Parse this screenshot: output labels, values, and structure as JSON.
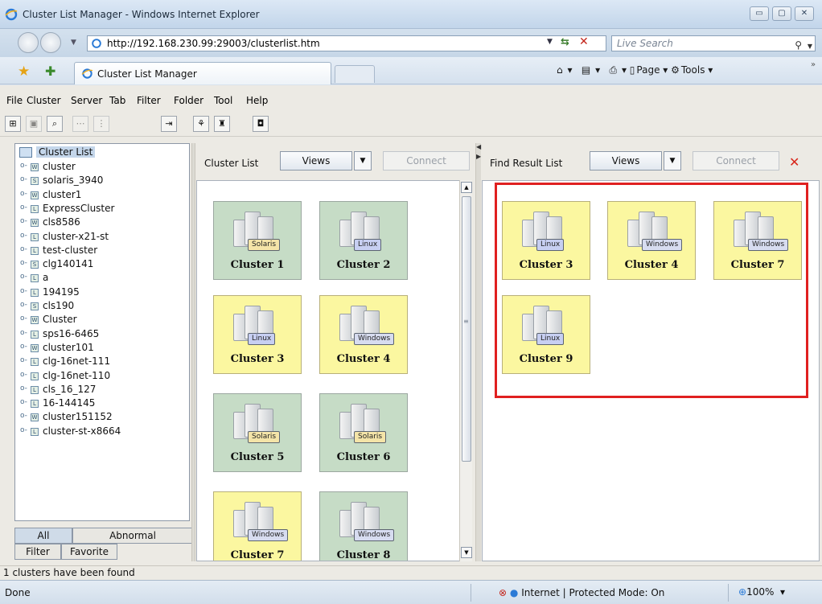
{
  "window": {
    "title": "Cluster List Manager - Windows Internet Explorer",
    "minimize": "▭",
    "maximize": "▢",
    "close": "✕"
  },
  "address": {
    "url": "http://192.168.230.99:29003/clusterlist.htm",
    "search_placeholder": "Live Search"
  },
  "tab": {
    "label": "Cluster List Manager"
  },
  "commands": {
    "page": "Page",
    "tools": "Tools"
  },
  "menu": [
    {
      "key": "F",
      "rest": "ile"
    },
    {
      "key": "C",
      "rest": "luster"
    },
    {
      "key": "S",
      "rest": "erver"
    },
    {
      "key": "",
      "rest": "Tab",
      "u_index": 2
    },
    {
      "key": "",
      "rest": "Filter"
    },
    {
      "key": "F",
      "rest": "older"
    },
    {
      "key": "T",
      "rest": "ool"
    },
    {
      "key": "H",
      "rest": "elp"
    }
  ],
  "menu_labels": [
    "File",
    "Cluster",
    "Server",
    "Tab",
    "Filter",
    "Folder",
    "Tool",
    "Help"
  ],
  "tree": {
    "root": "Cluster List",
    "items": [
      {
        "icon": "W",
        "label": "cluster"
      },
      {
        "icon": "S",
        "label": "solaris_3940"
      },
      {
        "icon": "W",
        "label": "cluster1"
      },
      {
        "icon": "L",
        "label": "ExpressCluster"
      },
      {
        "icon": "W",
        "label": "cls8586"
      },
      {
        "icon": "L",
        "label": "cluster-x21-st"
      },
      {
        "icon": "L",
        "label": "test-cluster"
      },
      {
        "icon": "S",
        "label": "clg140141"
      },
      {
        "icon": "L",
        "label": "a"
      },
      {
        "icon": "L",
        "label": "194195"
      },
      {
        "icon": "S",
        "label": "cls190"
      },
      {
        "icon": "W",
        "label": "Cluster"
      },
      {
        "icon": "L",
        "label": "sps16-6465"
      },
      {
        "icon": "W",
        "label": "cluster101"
      },
      {
        "icon": "L",
        "label": "clg-16net-111"
      },
      {
        "icon": "L",
        "label": "clg-16net-110"
      },
      {
        "icon": "L",
        "label": "cls_16_127"
      },
      {
        "icon": "L",
        "label": "16-144145"
      },
      {
        "icon": "W",
        "label": "cluster151152"
      },
      {
        "icon": "L",
        "label": "cluster-st-x8664"
      }
    ]
  },
  "bottom_tabs": {
    "all": "All",
    "abnormal": "Abnormal",
    "filter": "Filter",
    "favorite": "Favorite"
  },
  "cluster_list": {
    "title": "Cluster List",
    "views": "Views",
    "connect": "Connect",
    "cards": [
      {
        "name": "Cluster 1",
        "os": "Solaris",
        "color": "green"
      },
      {
        "name": "Cluster 2",
        "os": "Linux",
        "color": "green"
      },
      {
        "name": "Cluster 3",
        "os": "Linux",
        "color": "yellow"
      },
      {
        "name": "Cluster 4",
        "os": "Windows",
        "color": "yellow"
      },
      {
        "name": "Cluster 5",
        "os": "Solaris",
        "color": "green"
      },
      {
        "name": "Cluster 6",
        "os": "Solaris",
        "color": "green"
      },
      {
        "name": "Cluster 7",
        "os": "Windows",
        "color": "yellow"
      },
      {
        "name": "Cluster 8",
        "os": "Windows",
        "color": "green"
      }
    ]
  },
  "find_result": {
    "title": "Find Result List",
    "views": "Views",
    "connect": "Connect",
    "close": "✕",
    "cards": [
      {
        "name": "Cluster 3",
        "os": "Linux",
        "color": "yellow"
      },
      {
        "name": "Cluster 4",
        "os": "Windows",
        "color": "yellow"
      },
      {
        "name": "Cluster 7",
        "os": "Windows",
        "color": "yellow"
      },
      {
        "name": "Cluster 9",
        "os": "Linux",
        "color": "yellow"
      }
    ]
  },
  "status": {
    "app": "1 clusters have been found",
    "ie": "Done",
    "zone": "Internet | Protected Mode: On",
    "zoom": "100%"
  },
  "colors": {
    "card_green": "#c6dcc6",
    "card_yellow": "#fbf7a0",
    "highlight": "#e02020"
  }
}
